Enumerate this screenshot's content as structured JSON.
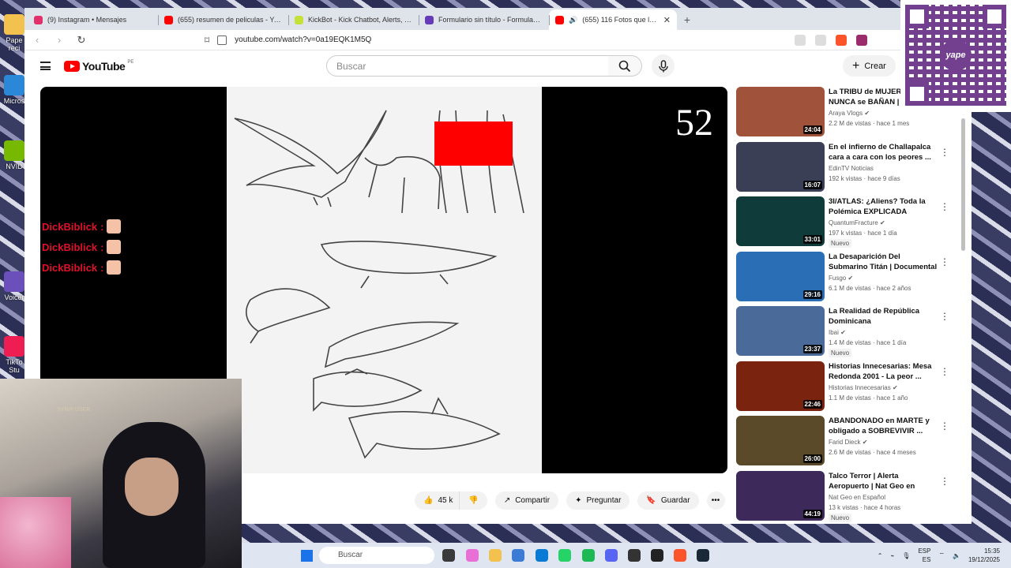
{
  "desktop": {
    "icons": [
      {
        "label": "Pape reci",
        "color": "#f2c14e"
      },
      {
        "label": "Micros",
        "color": "#2b88d8"
      },
      {
        "label": "NVID",
        "color": "#76b900"
      },
      {
        "label": "Voicer",
        "color": "#6b4fbb"
      },
      {
        "label": "TikTo Stu",
        "color": "#ee1d52"
      }
    ]
  },
  "browser": {
    "tabs": [
      {
        "title": "(9) Instagram • Mensajes",
        "color": "#e1306c"
      },
      {
        "title": "(655) resumen de peliculas - YouTube",
        "color": "#ff0000"
      },
      {
        "title": "KickBot - Kick Chatbot, Alerts, TTS, C",
        "color": "#c6e03a"
      },
      {
        "title": "Formulario sin título - Formularios de",
        "color": "#673ab7"
      },
      {
        "title": "(655) 116 Fotos que la NASA",
        "color": "#ff0000",
        "close": "✕"
      }
    ],
    "new_tab": "+",
    "url": "youtube.com/watch?v=0a19EQK1M5Q"
  },
  "youtube": {
    "logo_text": "YouTube",
    "country_code": "PE",
    "search_placeholder": "Buscar",
    "create_label": "Crear"
  },
  "player": {
    "counter": "52",
    "chat": [
      {
        "user": "DickBiblick",
        "sep": ":"
      },
      {
        "user": "DickBiblick",
        "sep": ":"
      },
      {
        "user": "DickBiblick",
        "sep": ":"
      }
    ]
  },
  "actions": {
    "likes": "45 k",
    "share": "Compartir",
    "ask": "Preguntar",
    "save": "Guardar",
    "more": "•••"
  },
  "sidebar": {
    "videos": [
      {
        "title": "La TRIBU de MUJERES que NUNCA se BAÑAN | L",
        "channel": "Araya Vlogs",
        "verified": true,
        "stats": "2.2 M de vistas · hace 1 mes",
        "duration": "24:04",
        "badge": "",
        "thumb": "#a0533a"
      },
      {
        "title": "En el infierno de Challapalca cara a cara con los peores ...",
        "channel": "EdinTV Noticias",
        "verified": false,
        "stats": "192 k vistas · hace 9 días",
        "duration": "16:07",
        "badge": "",
        "thumb": "#3a3f55"
      },
      {
        "title": "3I/ATLAS: ¿Aliens? Toda la Polémica EXPLICADA",
        "channel": "QuantumFracture",
        "verified": true,
        "stats": "197 k vistas · hace 1 día",
        "duration": "33:01",
        "badge": "Nuevo",
        "thumb": "#0f3b3a"
      },
      {
        "title": "La Desaparición Del Submarino Titán | Documental Completo",
        "channel": "Fusgo",
        "verified": true,
        "stats": "6.1 M de vistas · hace 2 años",
        "duration": "29:16",
        "badge": "",
        "thumb": "#2a6fb5"
      },
      {
        "title": "La Realidad de República Dominicana",
        "channel": "Ibai",
        "verified": true,
        "stats": "1.4 M de vistas · hace 1 día",
        "duration": "23:37",
        "badge": "Nuevo",
        "thumb": "#4a6a9a"
      },
      {
        "title": "Historias Innecesarias: Mesa Redonda 2001 - La peor ...",
        "channel": "Historias Innecesarias",
        "verified": true,
        "stats": "1.1 M de vistas · hace 1 año",
        "duration": "22:46",
        "badge": "",
        "thumb": "#7a2410"
      },
      {
        "title": "ABANDONADO en MARTE y obligado a SOBREVIVIR ...",
        "channel": "Farid Dieck",
        "verified": true,
        "stats": "2.6 M de vistas · hace 4 meses",
        "duration": "26:00",
        "badge": "",
        "thumb": "#5a4a2a"
      },
      {
        "title": "Talco Terror | Alerta Aeropuerto | Nat Geo en Español",
        "channel": "Nat Geo en Español",
        "verified": false,
        "stats": "13 k vistas · hace 4 horas",
        "duration": "44:19",
        "badge": "Nuevo",
        "thumb": "#3d2a5a"
      }
    ]
  },
  "overlay": {
    "qr_logo": "yape"
  },
  "webcam": {
    "caption": "SYRIP USER"
  },
  "taskbar": {
    "search": "Buscar",
    "lang_top": "ESP",
    "lang_bottom": "ES",
    "time": "15:35",
    "date": "19/12/2025"
  }
}
